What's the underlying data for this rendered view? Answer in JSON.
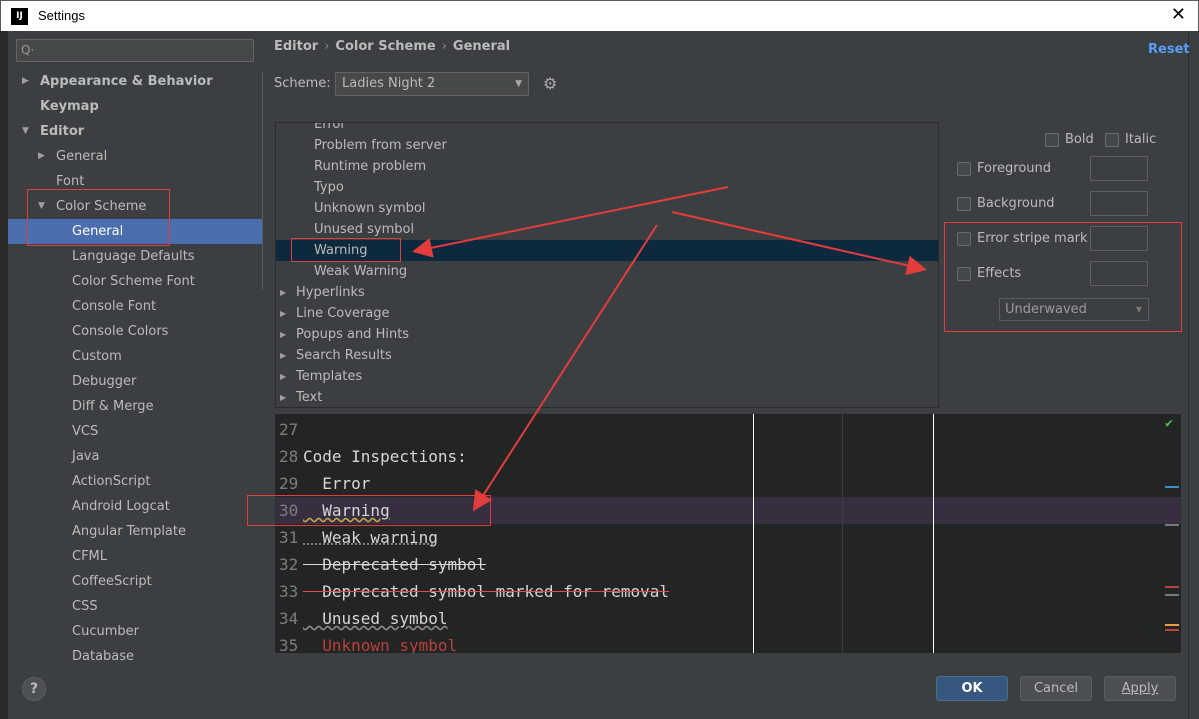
{
  "window": {
    "title": "Settings",
    "app_icon_label": "IJ",
    "close_label": "✕"
  },
  "search": {
    "placeholder": "Q·",
    "icon": "search-icon"
  },
  "sidebar": {
    "items": [
      {
        "label": "Appearance & Behavior",
        "level": 0,
        "arrow": "▶"
      },
      {
        "label": "Keymap",
        "level": 0,
        "arrow": ""
      },
      {
        "label": "Editor",
        "level": 0,
        "arrow": "▼"
      },
      {
        "label": "General",
        "level": 1,
        "arrow": "▶"
      },
      {
        "label": "Font",
        "level": 1,
        "arrow": ""
      },
      {
        "label": "Color Scheme",
        "level": 1,
        "arrow": "▼"
      },
      {
        "label": "General",
        "level": 2,
        "arrow": "",
        "selected": true
      },
      {
        "label": "Language Defaults",
        "level": 2,
        "arrow": ""
      },
      {
        "label": "Color Scheme Font",
        "level": 2,
        "arrow": ""
      },
      {
        "label": "Console Font",
        "level": 2,
        "arrow": ""
      },
      {
        "label": "Console Colors",
        "level": 2,
        "arrow": ""
      },
      {
        "label": "Custom",
        "level": 2,
        "arrow": ""
      },
      {
        "label": "Debugger",
        "level": 2,
        "arrow": ""
      },
      {
        "label": "Diff & Merge",
        "level": 2,
        "arrow": ""
      },
      {
        "label": "VCS",
        "level": 2,
        "arrow": ""
      },
      {
        "label": "Java",
        "level": 2,
        "arrow": ""
      },
      {
        "label": "ActionScript",
        "level": 2,
        "arrow": ""
      },
      {
        "label": "Android Logcat",
        "level": 2,
        "arrow": ""
      },
      {
        "label": "Angular Template",
        "level": 2,
        "arrow": ""
      },
      {
        "label": "CFML",
        "level": 2,
        "arrow": ""
      },
      {
        "label": "CoffeeScript",
        "level": 2,
        "arrow": ""
      },
      {
        "label": "CSS",
        "level": 2,
        "arrow": ""
      },
      {
        "label": "Cucumber",
        "level": 2,
        "arrow": ""
      },
      {
        "label": "Database",
        "level": 2,
        "arrow": ""
      }
    ]
  },
  "breadcrumb": {
    "items": [
      "Editor",
      "Color Scheme",
      "General"
    ],
    "separator": "›"
  },
  "reset_label": "Reset",
  "scheme": {
    "label": "Scheme:",
    "value": "Ladies Night 2"
  },
  "attributes": {
    "items": [
      {
        "label": "Error",
        "indent": true,
        "arrow": ""
      },
      {
        "label": "Problem from server",
        "indent": true,
        "arrow": ""
      },
      {
        "label": "Runtime problem",
        "indent": true,
        "arrow": ""
      },
      {
        "label": "Typo",
        "indent": true,
        "arrow": ""
      },
      {
        "label": "Unknown symbol",
        "indent": true,
        "arrow": ""
      },
      {
        "label": "Unused symbol",
        "indent": true,
        "arrow": ""
      },
      {
        "label": "Warning",
        "indent": true,
        "arrow": "",
        "selected": true
      },
      {
        "label": "Weak Warning",
        "indent": true,
        "arrow": ""
      },
      {
        "label": "Hyperlinks",
        "indent": false,
        "arrow": "▶"
      },
      {
        "label": "Line Coverage",
        "indent": false,
        "arrow": "▶"
      },
      {
        "label": "Popups and Hints",
        "indent": false,
        "arrow": "▶"
      },
      {
        "label": "Search Results",
        "indent": false,
        "arrow": "▶"
      },
      {
        "label": "Templates",
        "indent": false,
        "arrow": "▶"
      },
      {
        "label": "Text",
        "indent": false,
        "arrow": "▶"
      }
    ]
  },
  "properties": {
    "bold": "Bold",
    "italic": "Italic",
    "foreground": "Foreground",
    "background": "Background",
    "error_stripe": "Error stripe mark",
    "effects": "Effects",
    "effects_type": "Underwaved"
  },
  "preview": {
    "lines": [
      {
        "num": "27",
        "text": "",
        "style": ""
      },
      {
        "num": "28",
        "text": "Code Inspections:",
        "style": ""
      },
      {
        "num": "29",
        "text": "  Error",
        "style": ""
      },
      {
        "num": "30",
        "text": "  Warning",
        "style": "warn"
      },
      {
        "num": "31",
        "text": "  Weak warning",
        "style": "weak"
      },
      {
        "num": "32",
        "text": "  Deprecated symbol",
        "style": "deprecated"
      },
      {
        "num": "33",
        "text": "  Deprecated symbol marked for removal",
        "style": "deprec-removal"
      },
      {
        "num": "34",
        "text": "  Unused symbol",
        "style": "unused"
      },
      {
        "num": "35",
        "text": "  Unknown symbol",
        "style": "unknown"
      }
    ]
  },
  "buttons": {
    "help": "?",
    "ok": "OK",
    "cancel": "Cancel",
    "apply": "Apply"
  },
  "colors": {
    "selection": "#4b6eaf",
    "accent": "#589df6",
    "annotation": "#e23c3c",
    "ok_button": "#365880"
  }
}
